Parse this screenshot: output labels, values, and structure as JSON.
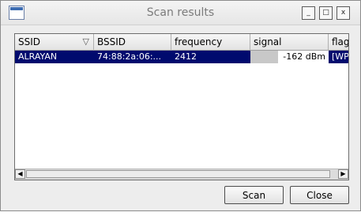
{
  "window": {
    "title": "Scan results",
    "controls": {
      "minimize": "_",
      "maximize": "□",
      "close": "x"
    }
  },
  "table": {
    "columns": [
      "SSID",
      "BSSID",
      "frequency",
      "signal",
      "flags"
    ],
    "sort_icon": "▽",
    "rows": [
      {
        "ssid": "ALRAYAN",
        "bssid": "74:88:2a:06:...",
        "frequency": "2412",
        "signal": "-162 dBm",
        "flags": "[WP",
        "signal_fraction": 0.35
      }
    ]
  },
  "buttons": {
    "scan": "Scan",
    "close": "Close"
  },
  "scrollbar": {
    "left_arrow": "◀",
    "right_arrow": "▶"
  }
}
